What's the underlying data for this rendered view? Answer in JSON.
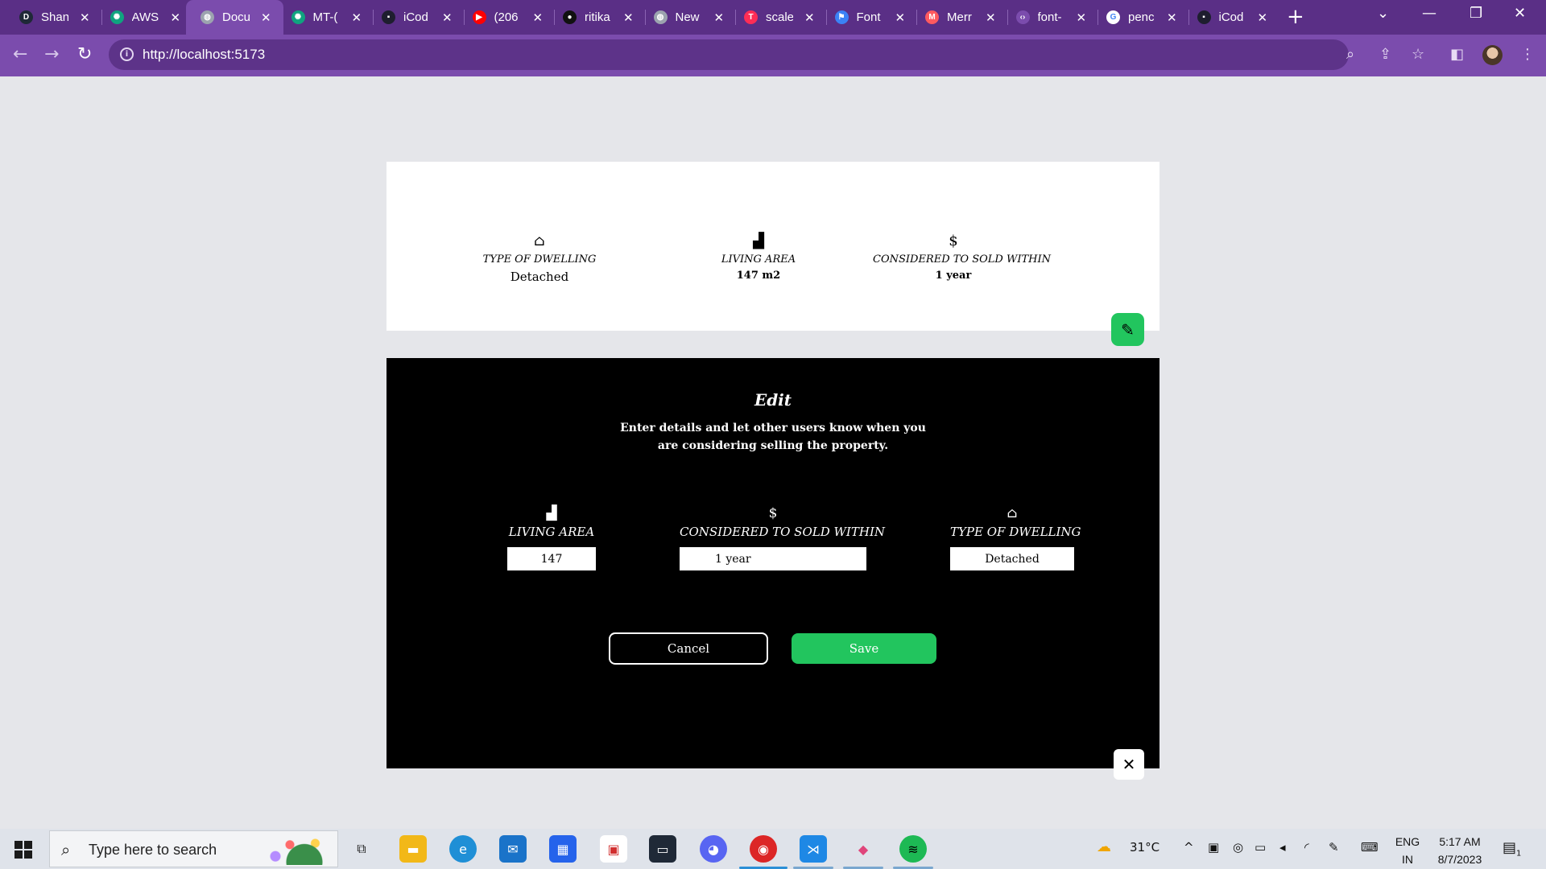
{
  "browser": {
    "tabs": [
      {
        "title": "Shan",
        "icon": "d-letter-icon",
        "color": "#1f2937",
        "glyph": "D"
      },
      {
        "title": "AWS",
        "icon": "chatgpt-icon",
        "color": "#10a37f",
        "glyph": "✺"
      },
      {
        "title": "Docu",
        "icon": "globe-icon",
        "color": "#9ca3af",
        "glyph": "◍",
        "active": true
      },
      {
        "title": "MT-(",
        "icon": "chatgpt-icon",
        "color": "#10a37f",
        "glyph": "✺"
      },
      {
        "title": "iCod",
        "icon": "icodeguru-icon",
        "color": "#1e1e2f",
        "glyph": "▪"
      },
      {
        "title": "(206",
        "icon": "youtube-icon",
        "color": "#ff0000",
        "glyph": "▶"
      },
      {
        "title": "ritika",
        "icon": "github-icon",
        "color": "#111111",
        "glyph": "●"
      },
      {
        "title": "New",
        "icon": "globe-icon",
        "color": "#9ca3af",
        "glyph": "◍"
      },
      {
        "title": "scale",
        "icon": "scaler-icon",
        "color": "#ff2d55",
        "glyph": "T"
      },
      {
        "title": "Font",
        "icon": "flag-icon",
        "color": "#3b82f6",
        "glyph": "⚑"
      },
      {
        "title": "Merr",
        "icon": "mermaid-icon",
        "color": "#ff5a5f",
        "glyph": "M"
      },
      {
        "title": "font-",
        "icon": "code-icon",
        "color": "#7b4cad",
        "glyph": "‹›"
      },
      {
        "title": "penc",
        "icon": "google-icon",
        "color": "#ffffff",
        "glyph": "G"
      },
      {
        "title": "iCod",
        "icon": "icodeguru-icon",
        "color": "#1e1e2f",
        "glyph": "▪"
      }
    ],
    "url": "http://localhost:5173"
  },
  "info_card": {
    "dwelling_label": "TYPE OF DWELLING",
    "dwelling_value": "Detached",
    "area_label": "LIVING AREA",
    "area_value": "147 m2",
    "sold_label": "CONSIDERED TO SOLD WITHIN",
    "sold_value": "1 year"
  },
  "edit_panel": {
    "title": "Edit",
    "description": "Enter details and let other users know when you are considering selling the property.",
    "area_label": "LIVING AREA",
    "area_value": "147",
    "sold_label": "CONSIDERED TO SOLD WITHIN",
    "sold_value": "1 year",
    "dwelling_label": "TYPE OF DWELLING",
    "dwelling_value": "Detached",
    "cancel_label": "Cancel",
    "save_label": "Save"
  },
  "colors": {
    "accent_green": "#22c55e",
    "browser_purple": "#7b4cad"
  },
  "taskbar": {
    "search_placeholder": "Type here to search",
    "weather": "31°C",
    "lang_1": "ENG",
    "lang_2": "IN",
    "time": "5:17 AM",
    "date": "8/7/2023",
    "notification_count": "1"
  }
}
